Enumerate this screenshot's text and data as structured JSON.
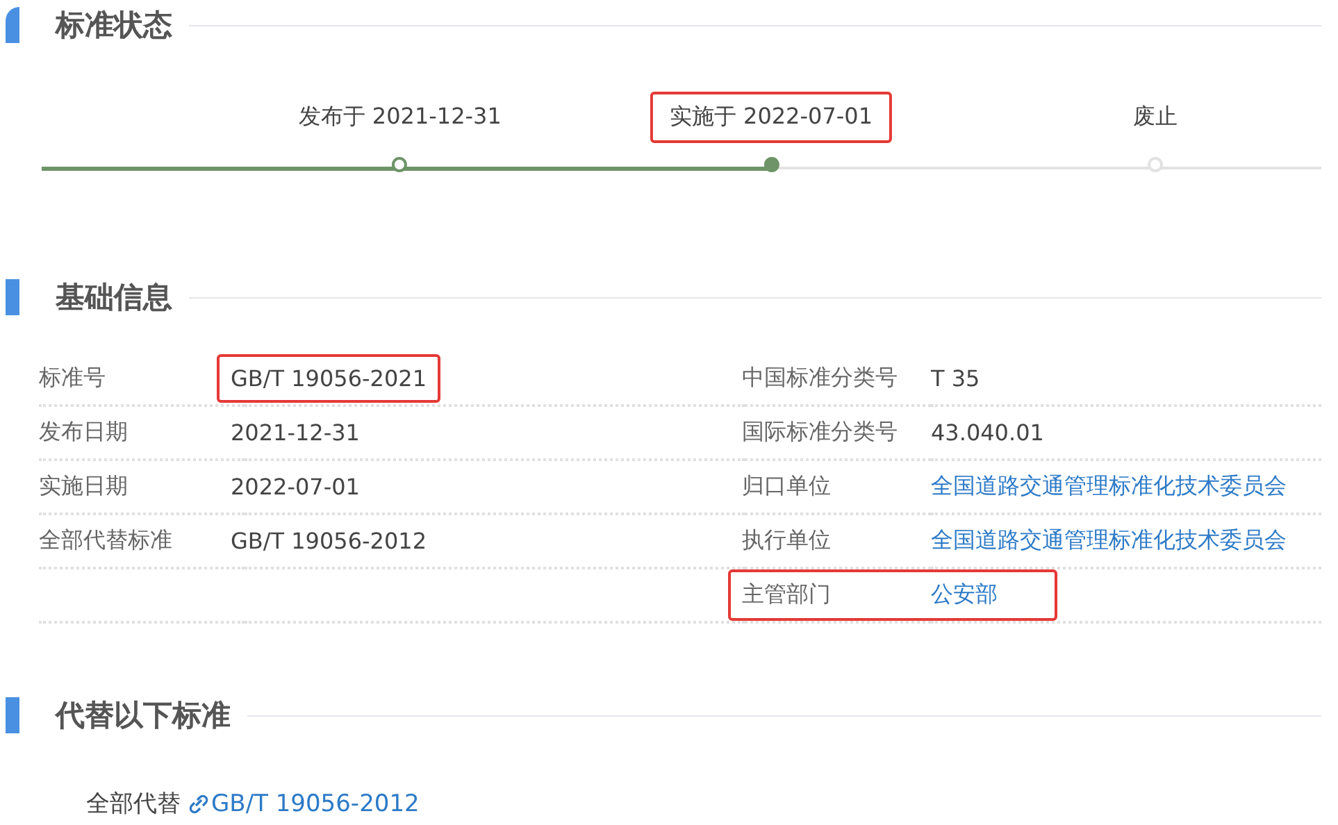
{
  "sections": [
    {
      "title": "标准状态"
    },
    {
      "title": "基础信息"
    },
    {
      "title": "代替以下标准"
    }
  ],
  "timeline": [
    {
      "label": "发布于 2021-12-31",
      "kind": "done",
      "highlighted": false
    },
    {
      "label": "实施于 2022-07-01",
      "kind": "current",
      "highlighted": true
    },
    {
      "label": "废止",
      "kind": "pending",
      "highlighted": false
    }
  ],
  "info_rows": [
    {
      "left": {
        "label": "标准号",
        "value": "GB/T 19056-2021",
        "link": false,
        "highlighted": true
      },
      "right": {
        "label": "中国标准分类号",
        "value": "T 35",
        "link": false,
        "highlighted": false
      }
    },
    {
      "left": {
        "label": "发布日期",
        "value": "2021-12-31",
        "link": false,
        "highlighted": false
      },
      "right": {
        "label": "国际标准分类号",
        "value": "43.040.01",
        "link": false,
        "highlighted": false
      }
    },
    {
      "left": {
        "label": "实施日期",
        "value": "2022-07-01",
        "link": false,
        "highlighted": false
      },
      "right": {
        "label": "归口单位",
        "value": "全国道路交通管理标准化技术委员会",
        "link": true,
        "highlighted": false
      }
    },
    {
      "left": {
        "label": "全部代替标准",
        "value": "GB/T 19056-2012",
        "link": false,
        "highlighted": false
      },
      "right": {
        "label": "执行单位",
        "value": "全国道路交通管理标准化技术委员会",
        "link": true,
        "highlighted": false
      }
    },
    {
      "right": {
        "label": "主管部门",
        "value": "公安部",
        "link": true,
        "highlighted": true
      }
    }
  ],
  "replaces": [
    {
      "label": "全部代替",
      "standard": "GB/T 19056-2012"
    }
  ]
}
